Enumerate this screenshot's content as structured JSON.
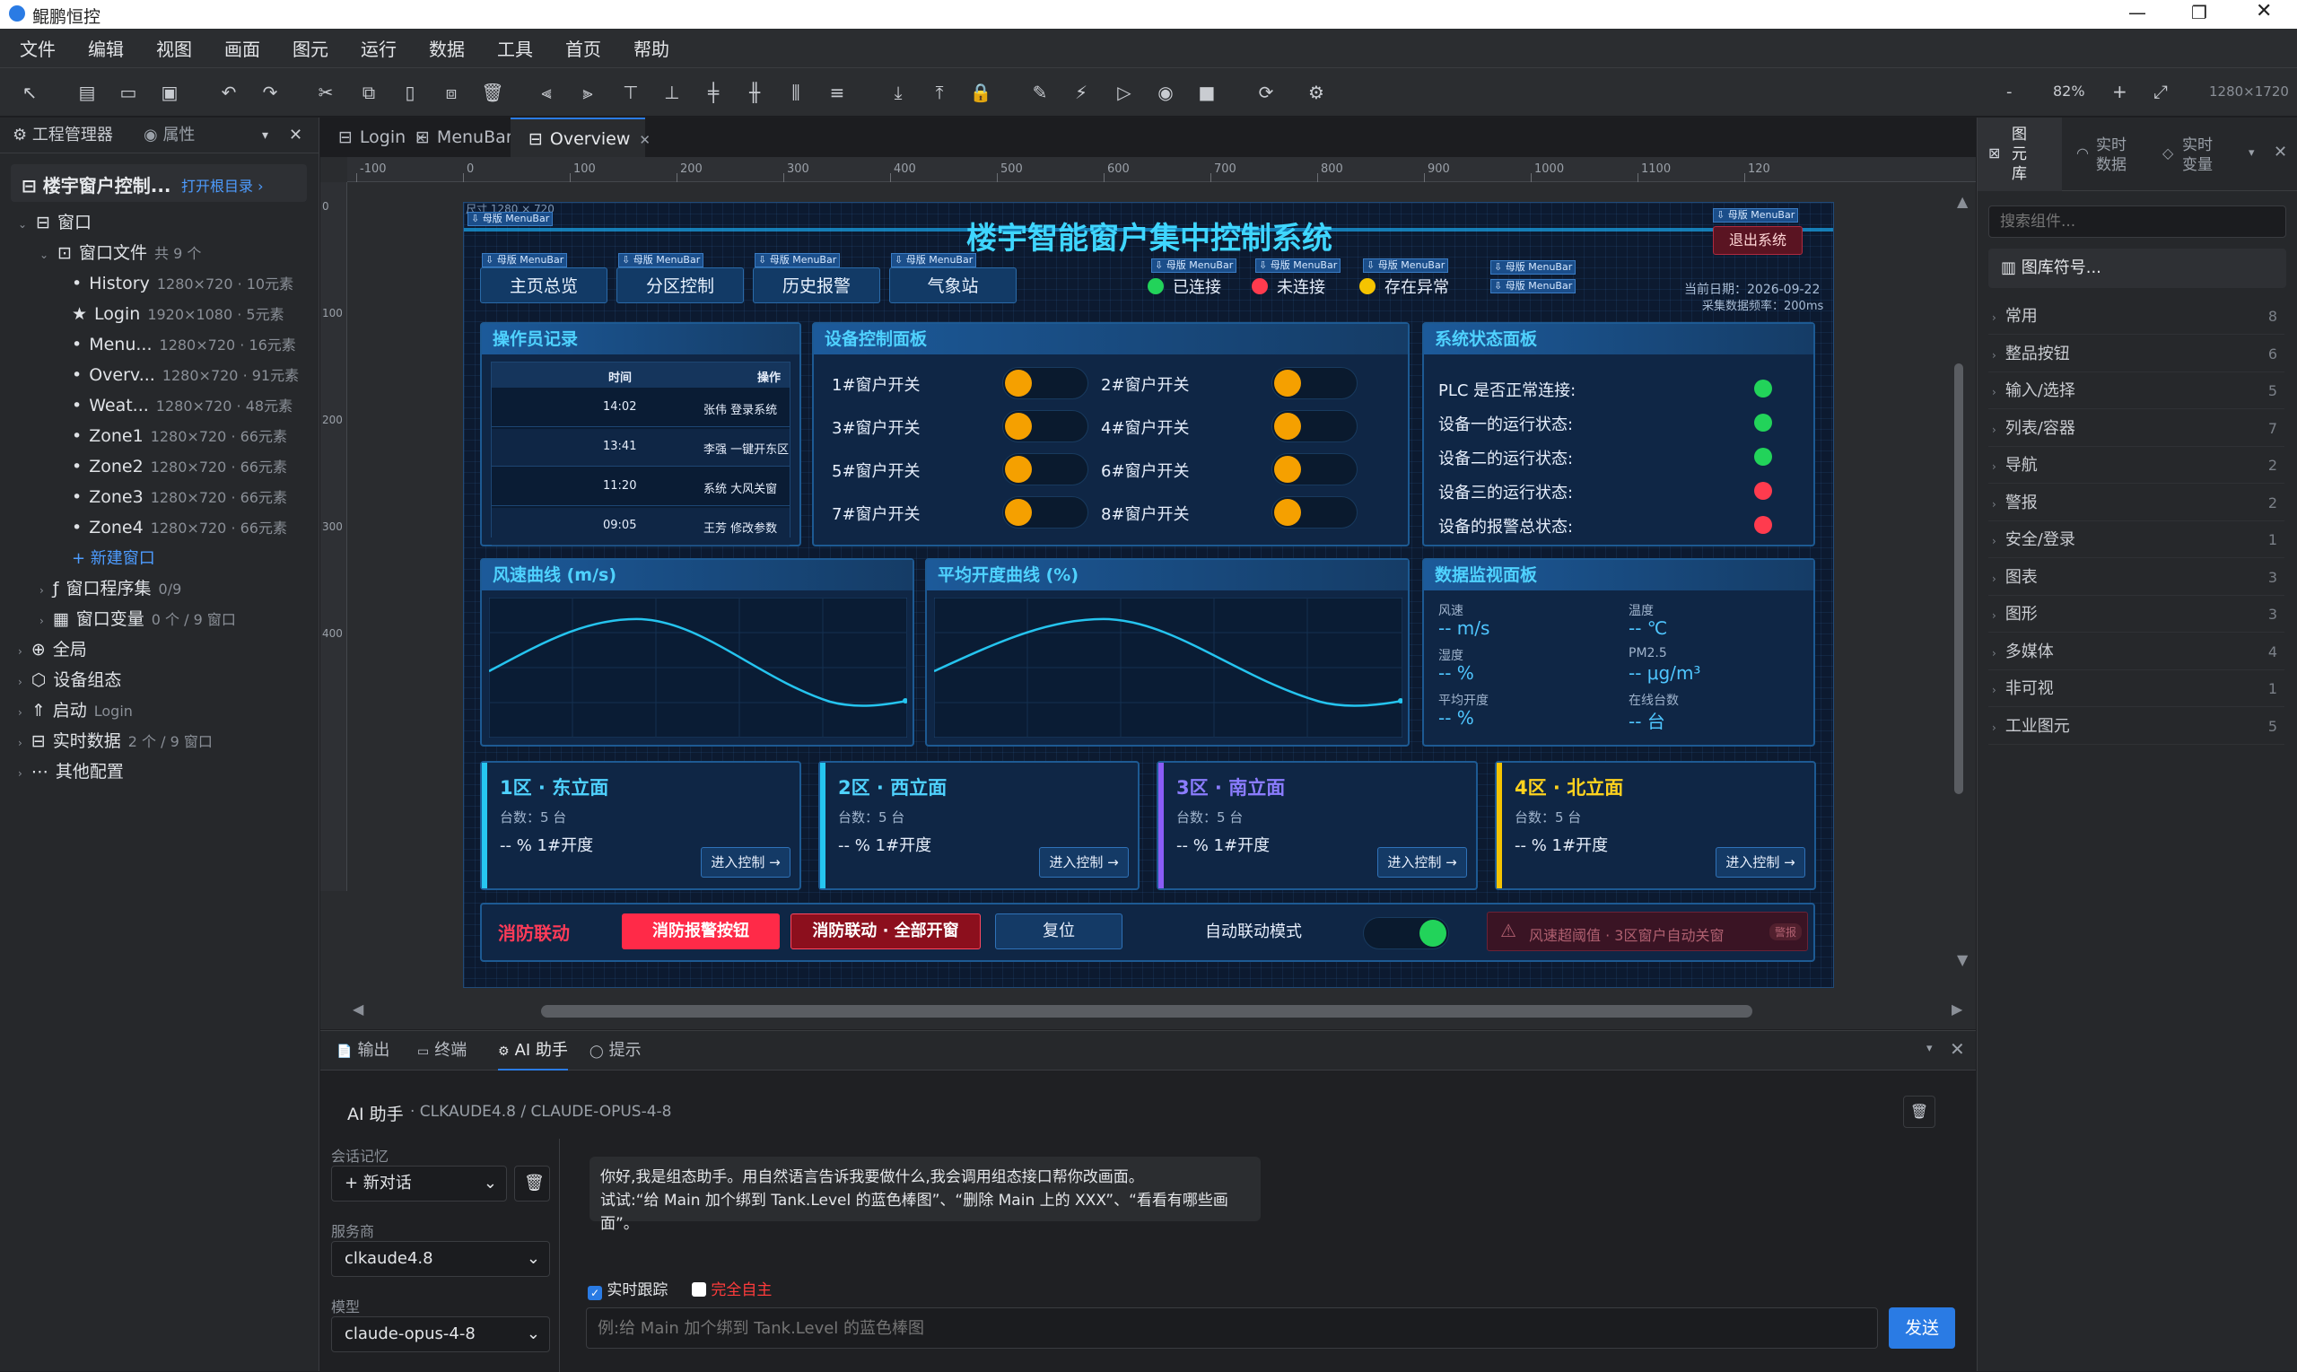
{
  "app": {
    "title": "鲲鹏恒控"
  },
  "menu": [
    "文件",
    "编辑",
    "视图",
    "画面",
    "图元",
    "运行",
    "数据",
    "工具",
    "首页",
    "帮助"
  ],
  "toolbar": {
    "zoom": "82%",
    "resolution": "1280×1720"
  },
  "left": {
    "tabs": [
      "工程管理器",
      "属性"
    ],
    "project": "楼宇窗户控制...",
    "open_root": "打开根目录 ›",
    "tree": [
      {
        "label": "窗口",
        "meta": "",
        "indent": 0,
        "icon": "window-icon"
      },
      {
        "label": "窗口文件",
        "meta": "共 9 个",
        "indent": 1,
        "icon": "folder-icon"
      },
      {
        "label": "History",
        "meta": "1280×720 · 10元素",
        "indent": 2,
        "icon": "bullet-icon"
      },
      {
        "label": "Login",
        "meta": "1920×1080 · 5元素",
        "indent": 2,
        "icon": "star-icon"
      },
      {
        "label": "Menu...",
        "meta": "1280×720 · 16元素",
        "indent": 2,
        "icon": "bullet-icon"
      },
      {
        "label": "Overv...",
        "meta": "1280×720 · 91元素",
        "indent": 2,
        "icon": "bullet-icon"
      },
      {
        "label": "Weat...",
        "meta": "1280×720 · 48元素",
        "indent": 2,
        "icon": "bullet-icon"
      },
      {
        "label": "Zone1",
        "meta": "1280×720 · 66元素",
        "indent": 2,
        "icon": "bullet-icon"
      },
      {
        "label": "Zone2",
        "meta": "1280×720 · 66元素",
        "indent": 2,
        "icon": "bullet-icon"
      },
      {
        "label": "Zone3",
        "meta": "1280×720 · 66元素",
        "indent": 2,
        "icon": "bullet-icon"
      },
      {
        "label": "Zone4",
        "meta": "1280×720 · 66元素",
        "indent": 2,
        "icon": "bullet-icon"
      },
      {
        "label": "+ 新建窗口",
        "meta": "",
        "indent": 2,
        "icon": "none"
      },
      {
        "label": "窗口程序集",
        "meta": "0/9",
        "indent": 1,
        "icon": "function-icon"
      },
      {
        "label": "窗口变量",
        "meta": "0 个 / 9 窗口",
        "indent": 1,
        "icon": "variable-icon"
      },
      {
        "label": "全局",
        "meta": "",
        "indent": 0,
        "icon": "globe-icon"
      },
      {
        "label": "设备组态",
        "meta": "",
        "indent": 0,
        "icon": "link-icon"
      },
      {
        "label": "启动",
        "meta": "Login",
        "indent": 0,
        "icon": "rocket-icon"
      },
      {
        "label": "实时数据",
        "meta": "2 个 / 9 窗口",
        "indent": 0,
        "icon": "database-icon"
      },
      {
        "label": "其他配置",
        "meta": "",
        "indent": 0,
        "icon": "more-icon"
      }
    ]
  },
  "doctabs": [
    "Login",
    "MenuBar",
    "Overview"
  ],
  "ruler": {
    "h": [
      "-100",
      "0",
      "100",
      "200",
      "300",
      "400",
      "500",
      "600",
      "700",
      "800",
      "900",
      "1000",
      "1100",
      "120"
    ],
    "v": [
      "0",
      "100",
      "200",
      "300",
      "400"
    ]
  },
  "design": {
    "size_label": "尺寸 1280 × 720",
    "title": "楼宇智能窗户集中控制系统",
    "exit": "退出系统",
    "menubar_tag": "⇩ 母版 MenuBar",
    "nav": [
      "主页总览",
      "分区控制",
      "历史报警",
      "气象站"
    ],
    "conn": [
      {
        "label": "已连接",
        "color": "#22d35a"
      },
      {
        "label": "未连接",
        "color": "#ff3b4e"
      },
      {
        "label": "存在异常",
        "color": "#f5c400"
      }
    ],
    "date": "当前日期：2026-09-22",
    "freq": "采集数据频率：200ms",
    "operator": {
      "title": "操作员记录",
      "cols": [
        "时间",
        "操作"
      ],
      "rows": [
        [
          "14:02",
          "张伟 登录系统"
        ],
        [
          "13:41",
          "李强 一键开东区"
        ],
        [
          "11:20",
          "系统 大风关窗"
        ],
        [
          "09:05",
          "王芳 修改参数"
        ]
      ]
    },
    "control": {
      "title": "设备控制面板",
      "switches": [
        "1#窗户开关",
        "2#窗户开关",
        "3#窗户开关",
        "4#窗户开关",
        "5#窗户开关",
        "6#窗户开关",
        "7#窗户开关",
        "8#窗户开关"
      ]
    },
    "status": {
      "title": "系统状态面板",
      "items": [
        {
          "label": "PLC 是否正常连接:",
          "color": "#22d35a"
        },
        {
          "label": "设备一的运行状态:",
          "color": "#22d35a"
        },
        {
          "label": "设备二的运行状态:",
          "color": "#22d35a"
        },
        {
          "label": "设备三的运行状态:",
          "color": "#ff3b4e"
        },
        {
          "label": "设备的报警总状态:",
          "color": "#ff3b4e"
        }
      ]
    },
    "wind": {
      "title": "风速曲线 (m/s)"
    },
    "open": {
      "title": "平均开度曲线 (%)"
    },
    "monitor": {
      "title": "数据监视面板",
      "items": [
        {
          "k": "风速",
          "v": "-- m/s"
        },
        {
          "k": "温度",
          "v": "-- ℃"
        },
        {
          "k": "湿度",
          "v": "-- %"
        },
        {
          "k": "PM2.5",
          "v": "-- μg/m³"
        },
        {
          "k": "平均开度",
          "v": "-- %"
        },
        {
          "k": "在线台数",
          "v": "-- 台"
        }
      ]
    },
    "zones": [
      {
        "title": "1区 · 东立面",
        "count": "台数：5 台",
        "val": "-- % 1#开度",
        "btn": "进入控制 →",
        "color": "#26c6f0"
      },
      {
        "title": "2区 · 西立面",
        "count": "台数：5 台",
        "val": "-- % 1#开度",
        "btn": "进入控制 →",
        "color": "#26c6f0"
      },
      {
        "title": "3区 · 南立面",
        "count": "台数：5 台",
        "val": "-- % 1#开度",
        "btn": "进入控制 →",
        "color": "#8b5cf6"
      },
      {
        "title": "4区 · 北立面",
        "count": "台数：5 台",
        "val": "-- % 1#开度",
        "btn": "进入控制 →",
        "color": "#f5c400"
      }
    ],
    "fire": {
      "title": "消防联动",
      "b1": "消防报警按钮",
      "b2": "消防联动 · 全部开窗",
      "b3": "复位",
      "auto": "自动联动模式",
      "alarm": "风速超阈值 · 3区窗户自动关窗",
      "alarm_tag": "警报"
    }
  },
  "right": {
    "tabs": [
      "图元库",
      "实时数据",
      "实时变量"
    ],
    "search_placeholder": "搜索组件...",
    "symbol_lib": "图库符号...",
    "cats": [
      [
        "常用",
        "8"
      ],
      [
        "整品按钮",
        "6"
      ],
      [
        "输入/选择",
        "5"
      ],
      [
        "列表/容器",
        "7"
      ],
      [
        "导航",
        "2"
      ],
      [
        "警报",
        "2"
      ],
      [
        "安全/登录",
        "1"
      ],
      [
        "图表",
        "3"
      ],
      [
        "图形",
        "3"
      ],
      [
        "多媒体",
        "4"
      ],
      [
        "非可视",
        "1"
      ],
      [
        "工业图元",
        "5"
      ]
    ]
  },
  "bottom": {
    "tabs": [
      "输出",
      "终端",
      "AI 助手",
      "提示"
    ],
    "header": "AI 助手",
    "model_line": "· CLKAUDE4.8 / CLAUDE-OPUS-4-8",
    "memory_label": "会话记忆",
    "new_chat": "+ 新对话",
    "provider_label": "服务商",
    "provider": "clkaude4.8",
    "model_label": "模型",
    "model": "claude-opus-4-8",
    "msg1": "你好,我是组态助手。用自然语言告诉我要做什么,我会调用组态接口帮你改画面。",
    "msg2": "试试:“给 Main 加个绑到 Tank.Level 的蓝色棒图”、“删除 Main 上的 XXX”、“看看有哪些画面”。",
    "track": "实时跟踪",
    "auto": "完全自主",
    "placeholder": "例:给 Main 加个绑到 Tank.Level 的蓝色棒图",
    "send": "发送"
  }
}
